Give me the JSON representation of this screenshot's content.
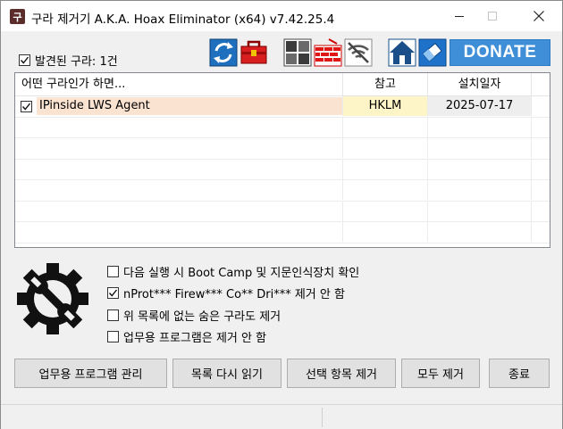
{
  "window": {
    "icon_glyph": "구",
    "title": "구라 제거기 A.K.A. Hoax Eliminator (x64) v7.42.25.4"
  },
  "toolbar": {
    "found_label": "발견된 구라: 1건",
    "found_checked": true,
    "icons": [
      "refresh-icon",
      "toolbox-icon",
      "windows-grid-icon",
      "firewall-icon",
      "wifi-off-icon",
      "home-icon",
      "eraser-icon"
    ],
    "donate_label": "DONATE"
  },
  "list": {
    "columns": [
      "어떤 구라인가 하면...",
      "참고",
      "설치일자"
    ],
    "rows": [
      {
        "checked": true,
        "name": "IPinside LWS Agent",
        "ref": "HKLM",
        "date": "2025-07-17"
      }
    ]
  },
  "options": [
    {
      "checked": false,
      "label": "다음 실행 시 Boot Camp 및 지문인식장치 확인"
    },
    {
      "checked": true,
      "label": "nProt*** Firew*** Co** Dri*** 제거 안 함"
    },
    {
      "checked": false,
      "label": "위 목록에 없는 숨은 구라도 제거"
    },
    {
      "checked": false,
      "label": "업무용 프로그램은 제거 안 함"
    }
  ],
  "buttons": {
    "manage_business": "업무용 프로그램 관리",
    "reload_list": "목록 다시 읽기",
    "remove_selected": "선택 항목 제거",
    "remove_all": "모두 제거",
    "exit": "종료"
  },
  "colors": {
    "donate_bg": "#3f8ed8",
    "row_name_bg": "#fbe3d2",
    "row_ref_bg": "#fdf5c8",
    "row_date_bg": "#eeeeee"
  }
}
